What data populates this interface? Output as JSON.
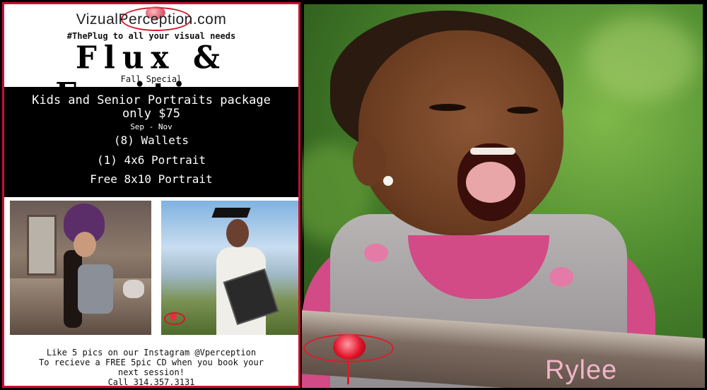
{
  "flyer": {
    "site": "VizualPerception.com",
    "tagline": "#ThePlug to all your visual needs",
    "title": "Flux & Fruition",
    "subtitle": "Fall Special",
    "package": {
      "title": "Kids and Senior Portraits package",
      "price": "only $75",
      "dates": "Sep -  Nov",
      "items": [
        "(8) Wallets",
        "(1) 4x6 Portrait",
        "Free 8x10 Portrait"
      ]
    },
    "promo": {
      "line1": "Like 5 pics on our Instagram @Vperception",
      "line2": "To recieve a FREE 5pic CD when you book your",
      "line3": "next session!",
      "line4": "Call 314.357.3131"
    },
    "accent": "#c8102e"
  },
  "main_photo": {
    "name": "Rylee"
  }
}
